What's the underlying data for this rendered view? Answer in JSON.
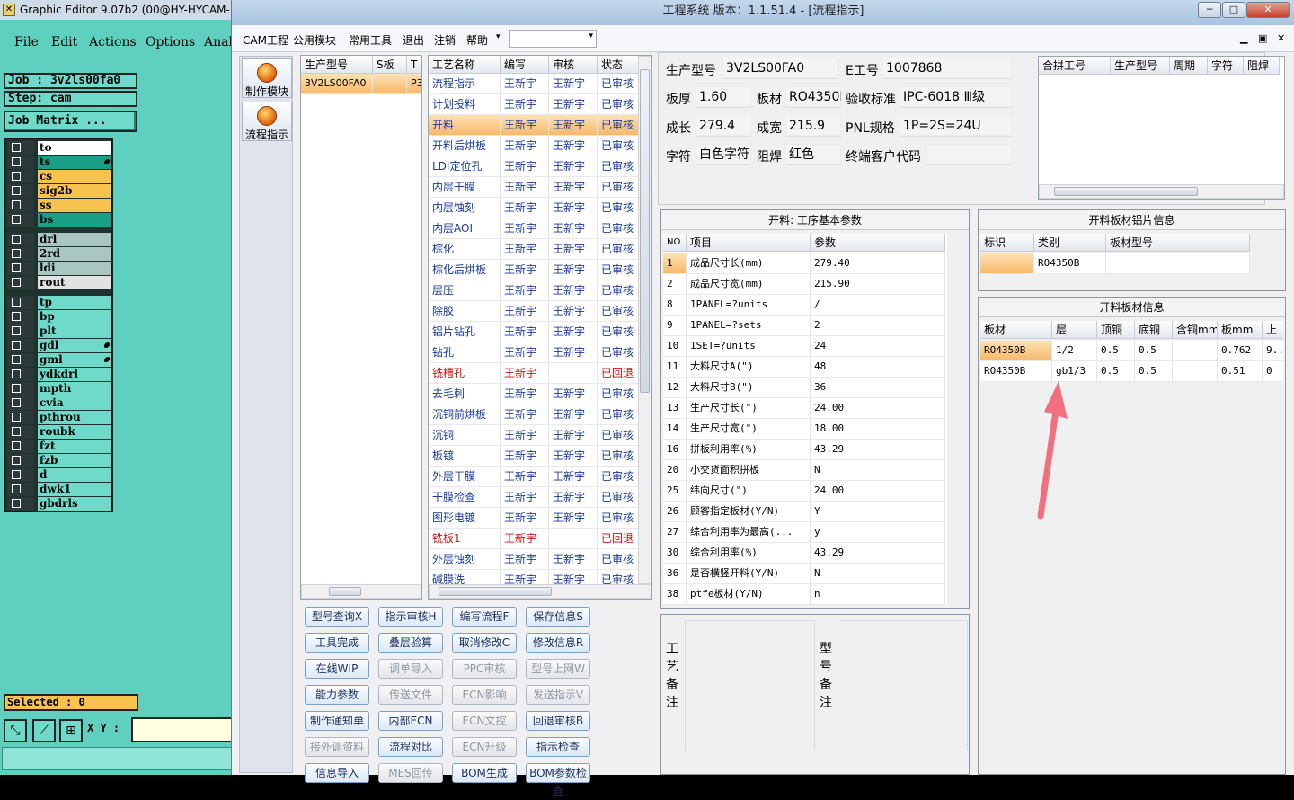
{
  "graphic_editor": {
    "title": "Graphic Editor 9.07b2 (00@HY-HYCAM-",
    "menu": [
      "File",
      "Edit",
      "Actions",
      "Options",
      "Anal"
    ],
    "job": "Job : 3v2ls00fa0",
    "step": "Step: cam",
    "job_matrix": "Job Matrix ...",
    "layers": [
      {
        "name": "to",
        "color": "#ffffff",
        "edit": false
      },
      {
        "name": "ts",
        "color": "#1aa087",
        "edit": true
      },
      {
        "name": "cs",
        "color": "#f7c34e",
        "edit": false
      },
      {
        "name": "sig2b",
        "color": "#f7c34e",
        "edit": false
      },
      {
        "name": "ss",
        "color": "#f7c34e",
        "edit": false
      },
      {
        "name": "bs",
        "color": "#1aa087",
        "edit": false
      },
      {
        "name": "drl",
        "color": "#a9c6c2",
        "edit": false
      },
      {
        "name": "2rd",
        "color": "#a9c6c2",
        "edit": false
      },
      {
        "name": "ldi",
        "color": "#a9c6c2",
        "edit": false
      },
      {
        "name": "rout",
        "color": "#e2e2e2",
        "edit": false
      },
      {
        "name": "tp",
        "color": "#6fdac9",
        "edit": false
      },
      {
        "name": "bp",
        "color": "#6fdac9",
        "edit": false
      },
      {
        "name": "plt",
        "color": "#6fdac9",
        "edit": false
      },
      {
        "name": "gdl",
        "color": "#6fdac9",
        "edit": true
      },
      {
        "name": "gml",
        "color": "#6fdac9",
        "edit": true
      },
      {
        "name": "ydkdrl",
        "color": "#6fdac9",
        "edit": false
      },
      {
        "name": "mpth",
        "color": "#6fdac9",
        "edit": false
      },
      {
        "name": "cvia",
        "color": "#6fdac9",
        "edit": false
      },
      {
        "name": "pthrou",
        "color": "#6fdac9",
        "edit": false
      },
      {
        "name": "roubk",
        "color": "#6fdac9",
        "edit": false
      },
      {
        "name": "fzt",
        "color": "#6fdac9",
        "edit": false
      },
      {
        "name": "fzb",
        "color": "#6fdac9",
        "edit": false
      },
      {
        "name": "d",
        "color": "#6fdac9",
        "edit": false
      },
      {
        "name": "dwk1",
        "color": "#6fdac9",
        "edit": false
      },
      {
        "name": "gbdrls",
        "color": "#6fdac9",
        "edit": false
      }
    ],
    "selected": "Selected : 0",
    "xy_label": "X Y :",
    "xy_value": ""
  },
  "cam": {
    "title": "工程系统   版本：1.1.51.4 - [流程指示]",
    "menu": [
      "CAM工程",
      "公用模块",
      "常用工具",
      "退出",
      "注销",
      "帮助"
    ],
    "menu_dropdown_icon": "▾",
    "nav": [
      "制作模块",
      "流程指示"
    ],
    "model_grid": {
      "headers": [
        "生产型号",
        "S板",
        "T"
      ],
      "rows": [
        [
          "3V2LS00FA0",
          "",
          "P3"
        ]
      ]
    },
    "process_grid": {
      "headers": [
        "工艺名称",
        "编写",
        "审核",
        "状态"
      ],
      "rows": [
        {
          "name": "流程指示",
          "writer": "王新宇",
          "reviewer": "王新宇",
          "status": "已审核",
          "red": false,
          "sel": false
        },
        {
          "name": "计划投料",
          "writer": "王新宇",
          "reviewer": "王新宇",
          "status": "已审核",
          "red": false,
          "sel": false
        },
        {
          "name": "开料",
          "writer": "王新宇",
          "reviewer": "王新宇",
          "status": "已审核",
          "red": false,
          "sel": true
        },
        {
          "name": "开料后烘板",
          "writer": "王新宇",
          "reviewer": "王新宇",
          "status": "已审核",
          "red": false,
          "sel": false
        },
        {
          "name": "LDI定位孔",
          "writer": "王新宇",
          "reviewer": "王新宇",
          "status": "已审核",
          "red": false,
          "sel": false
        },
        {
          "name": "内层干膜",
          "writer": "王新宇",
          "reviewer": "王新宇",
          "status": "已审核",
          "red": false,
          "sel": false
        },
        {
          "name": "内层蚀刻",
          "writer": "王新宇",
          "reviewer": "王新宇",
          "status": "已审核",
          "red": false,
          "sel": false
        },
        {
          "name": "内层AOI",
          "writer": "王新宇",
          "reviewer": "王新宇",
          "status": "已审核",
          "red": false,
          "sel": false
        },
        {
          "name": "棕化",
          "writer": "王新宇",
          "reviewer": "王新宇",
          "status": "已审核",
          "red": false,
          "sel": false
        },
        {
          "name": "棕化后烘板",
          "writer": "王新宇",
          "reviewer": "王新宇",
          "status": "已审核",
          "red": false,
          "sel": false
        },
        {
          "name": "层压",
          "writer": "王新宇",
          "reviewer": "王新宇",
          "status": "已审核",
          "red": false,
          "sel": false
        },
        {
          "name": "除胶",
          "writer": "王新宇",
          "reviewer": "王新宇",
          "status": "已审核",
          "red": false,
          "sel": false
        },
        {
          "name": "铝片钻孔",
          "writer": "王新宇",
          "reviewer": "王新宇",
          "status": "已审核",
          "red": false,
          "sel": false
        },
        {
          "name": "钻孔",
          "writer": "王新宇",
          "reviewer": "王新宇",
          "status": "已审核",
          "red": false,
          "sel": false
        },
        {
          "name": "铣槽孔",
          "writer": "王新宇",
          "reviewer": "",
          "status": "已回退",
          "red": true,
          "sel": false
        },
        {
          "name": "去毛刺",
          "writer": "王新宇",
          "reviewer": "王新宇",
          "status": "已审核",
          "red": false,
          "sel": false
        },
        {
          "name": "沉铜前烘板",
          "writer": "王新宇",
          "reviewer": "王新宇",
          "status": "已审核",
          "red": false,
          "sel": false
        },
        {
          "name": "沉铜",
          "writer": "王新宇",
          "reviewer": "王新宇",
          "status": "已审核",
          "red": false,
          "sel": false
        },
        {
          "name": "板镀",
          "writer": "王新宇",
          "reviewer": "王新宇",
          "status": "已审核",
          "red": false,
          "sel": false
        },
        {
          "name": "外层干膜",
          "writer": "王新宇",
          "reviewer": "王新宇",
          "status": "已审核",
          "red": false,
          "sel": false
        },
        {
          "name": "干膜检查",
          "writer": "王新宇",
          "reviewer": "王新宇",
          "status": "已审核",
          "red": false,
          "sel": false
        },
        {
          "name": "图形电镀",
          "writer": "王新宇",
          "reviewer": "王新宇",
          "status": "已审核",
          "red": false,
          "sel": false
        },
        {
          "name": "铣板1",
          "writer": "王新宇",
          "reviewer": "",
          "status": "已回退",
          "red": true,
          "sel": false
        },
        {
          "name": "外层蚀刻",
          "writer": "王新宇",
          "reviewer": "王新宇",
          "status": "已审核",
          "red": false,
          "sel": false
        },
        {
          "name": "碱膜洗",
          "writer": "王新宇",
          "reviewer": "王新宇",
          "status": "已审核",
          "red": false,
          "sel": false
        }
      ]
    },
    "buttons": [
      {
        "label": "型号查询X",
        "enabled": true
      },
      {
        "label": "指示审核H",
        "enabled": true
      },
      {
        "label": "编写流程F",
        "enabled": true
      },
      {
        "label": "保存信息S",
        "enabled": true
      },
      {
        "label": "工具完成",
        "enabled": true
      },
      {
        "label": "叠层验算",
        "enabled": true
      },
      {
        "label": "取消修改C",
        "enabled": true
      },
      {
        "label": "修改信息R",
        "enabled": true
      },
      {
        "label": "在线WIP",
        "enabled": true
      },
      {
        "label": "调单导入",
        "enabled": false
      },
      {
        "label": "PPC审核",
        "enabled": false
      },
      {
        "label": "型号上网W",
        "enabled": false
      },
      {
        "label": "能力参数",
        "enabled": true
      },
      {
        "label": "传送文件",
        "enabled": false
      },
      {
        "label": "ECN影响",
        "enabled": false
      },
      {
        "label": "发送指示V",
        "enabled": false
      },
      {
        "label": "制作通知单",
        "enabled": true
      },
      {
        "label": "内部ECN",
        "enabled": true
      },
      {
        "label": "ECN文控",
        "enabled": false
      },
      {
        "label": "回退审核B",
        "enabled": true
      },
      {
        "label": "接外调资料",
        "enabled": false
      },
      {
        "label": "流程对比",
        "enabled": true
      },
      {
        "label": "ECN升级",
        "enabled": false
      },
      {
        "label": "指示检查",
        "enabled": true
      },
      {
        "label": "信息导入",
        "enabled": true
      },
      {
        "label": "MES回传",
        "enabled": false
      },
      {
        "label": "BOM生成",
        "enabled": true
      },
      {
        "label": "BOM参数检查",
        "enabled": true
      }
    ],
    "info": {
      "model_label": "生产型号",
      "model_value": "3V2LS00FA0",
      "e_label": "E工号",
      "e_value": "1007868",
      "thick_label": "板厚",
      "thick_value": "1.60",
      "mat_label": "板材",
      "mat_value": "RO4350B",
      "std_label": "验收标准",
      "std_value": "IPC-6018 Ⅲ级",
      "len_label": "成长",
      "len_value": "279.4",
      "wid_label": "成宽",
      "wid_value": "215.9",
      "pnl_label": "PNL规格",
      "pnl_value": "1P=2S=24U",
      "char_label": "字符",
      "char_value": "白色字符",
      "mask_label": "阻焊",
      "mask_value": "红色",
      "cust_label": "终端客户代码",
      "cust_value": ""
    },
    "merge_grid": {
      "headers": [
        "合拼工号",
        "生产型号",
        "周期",
        "字符",
        "阻焊"
      ]
    },
    "param_panel": {
      "title": "开料: 工序基本参数",
      "headers": [
        "NO",
        "项目",
        "参数"
      ],
      "rows": [
        [
          "1",
          "成品尺寸长(mm)",
          "279.40"
        ],
        [
          "2",
          "成品尺寸宽(mm)",
          "215.90"
        ],
        [
          "8",
          "1PANEL=?units",
          "/"
        ],
        [
          "9",
          "1PANEL=?sets",
          "2"
        ],
        [
          "10",
          "1SET=?units",
          "24"
        ],
        [
          "11",
          "大料尺寸A(\")",
          "48"
        ],
        [
          "12",
          "大料尺寸B(\")",
          "36"
        ],
        [
          "13",
          "生产尺寸长(\")",
          "24.00"
        ],
        [
          "14",
          "生产尺寸宽(\")",
          "18.00"
        ],
        [
          "16",
          "拼板利用率(%)",
          "43.29"
        ],
        [
          "20",
          "小交货面积拼板",
          "N"
        ],
        [
          "25",
          "纬向尺寸(\")",
          "24.00"
        ],
        [
          "26",
          "顾客指定板材(Y/N)",
          "Y"
        ],
        [
          "27",
          "综合利用率为最高(...",
          "y"
        ],
        [
          "30",
          "综合利用率(%)",
          "43.29"
        ],
        [
          "36",
          "是否横竖开料(Y/N)",
          "N"
        ],
        [
          "38",
          "ptfe板材(Y/N)",
          "n"
        ]
      ]
    },
    "notes": {
      "process_label": "工艺备注",
      "model_label": "型号备注"
    },
    "al_panel": {
      "title": "开料板材铝片信息",
      "headers": [
        "标识",
        "类别",
        "板材型号"
      ],
      "rows": [
        [
          "",
          "RO4350B",
          ""
        ]
      ]
    },
    "board_panel": {
      "title": "开料板材信息",
      "headers": [
        "板材",
        "层",
        "顶铜",
        "底铜",
        "含铜mm",
        "板mm",
        "上"
      ],
      "rows": [
        [
          "RO4350B",
          "1/2",
          "0.5",
          "0.5",
          "",
          "0.762",
          "9..."
        ],
        [
          "RO4350B",
          "gb1/3",
          "0.5",
          "0.5",
          "",
          "0.51",
          "0"
        ]
      ]
    },
    "arrow_color": "#f07080"
  }
}
